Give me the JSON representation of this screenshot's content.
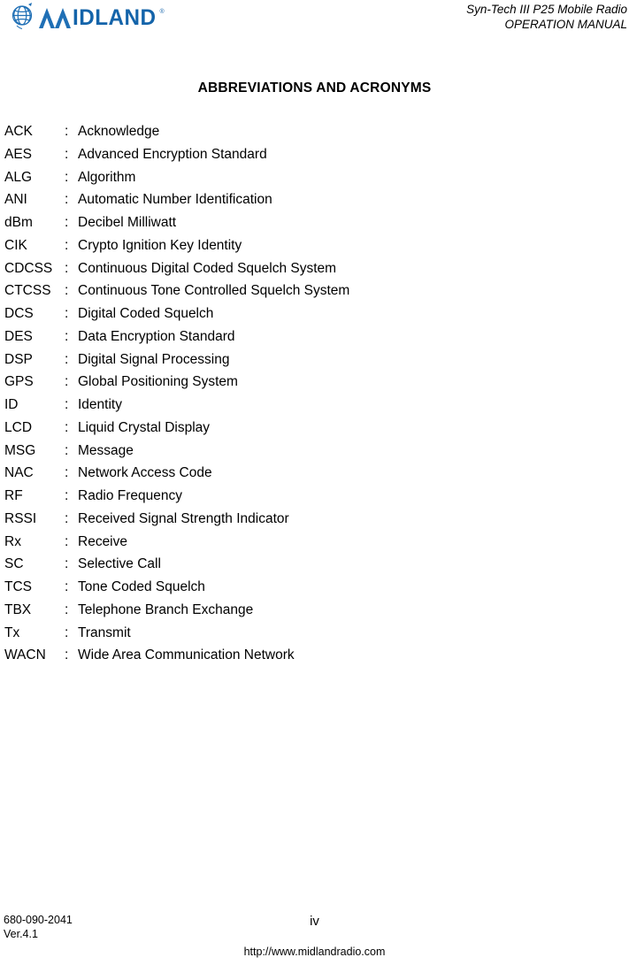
{
  "header": {
    "logo": {
      "icon": "globe-icon",
      "wordmark": "IDLAND",
      "registered_mark": "®",
      "color": "#1464aa"
    },
    "manual_line1": "Syn-Tech III P25 Mobile Radio",
    "manual_line2": "OPERATION MANUAL"
  },
  "title": "ABBREVIATIONS AND ACRONYMS",
  "separator": ":",
  "abbreviations": [
    {
      "term": "ACK",
      "definition": "Acknowledge"
    },
    {
      "term": "AES",
      "definition": "Advanced Encryption Standard"
    },
    {
      "term": "ALG",
      "definition": "Algorithm"
    },
    {
      "term": "ANI",
      "definition": "Automatic Number Identification"
    },
    {
      "term": "dBm",
      "definition": "Decibel Milliwatt"
    },
    {
      "term": "CIK",
      "definition": "Crypto Ignition Key Identity"
    },
    {
      "term": "CDCSS",
      "definition": "Continuous Digital Coded Squelch System"
    },
    {
      "term": "CTCSS",
      "definition": "Continuous Tone Controlled Squelch System"
    },
    {
      "term": "DCS",
      "definition": "Digital Coded Squelch"
    },
    {
      "term": "DES",
      "definition": "Data Encryption Standard"
    },
    {
      "term": "DSP",
      "definition": "Digital Signal Processing"
    },
    {
      "term": "GPS",
      "definition": "Global Positioning System"
    },
    {
      "term": "ID",
      "definition": "Identity"
    },
    {
      "term": "LCD",
      "definition": "Liquid Crystal Display"
    },
    {
      "term": "MSG",
      "definition": "Message"
    },
    {
      "term": "NAC",
      "definition": "Network Access Code"
    },
    {
      "term": "RF",
      "definition": "Radio Frequency"
    },
    {
      "term": "RSSI",
      "definition": "Received Signal Strength Indicator"
    },
    {
      "term": "Rx",
      "definition": "Receive"
    },
    {
      "term": "SC",
      "definition": "Selective Call"
    },
    {
      "term": "TCS",
      "definition": "Tone Coded Squelch"
    },
    {
      "term": "TBX",
      "definition": "Telephone Branch Exchange"
    },
    {
      "term": "Tx",
      "definition": "Transmit"
    },
    {
      "term": "WACN",
      "definition": "Wide Area Communication Network"
    }
  ],
  "footer": {
    "doc_number": "680-090-2041",
    "version": "Ver.4.1",
    "page_number": "iv",
    "url": "http://www.midlandradio.com"
  }
}
